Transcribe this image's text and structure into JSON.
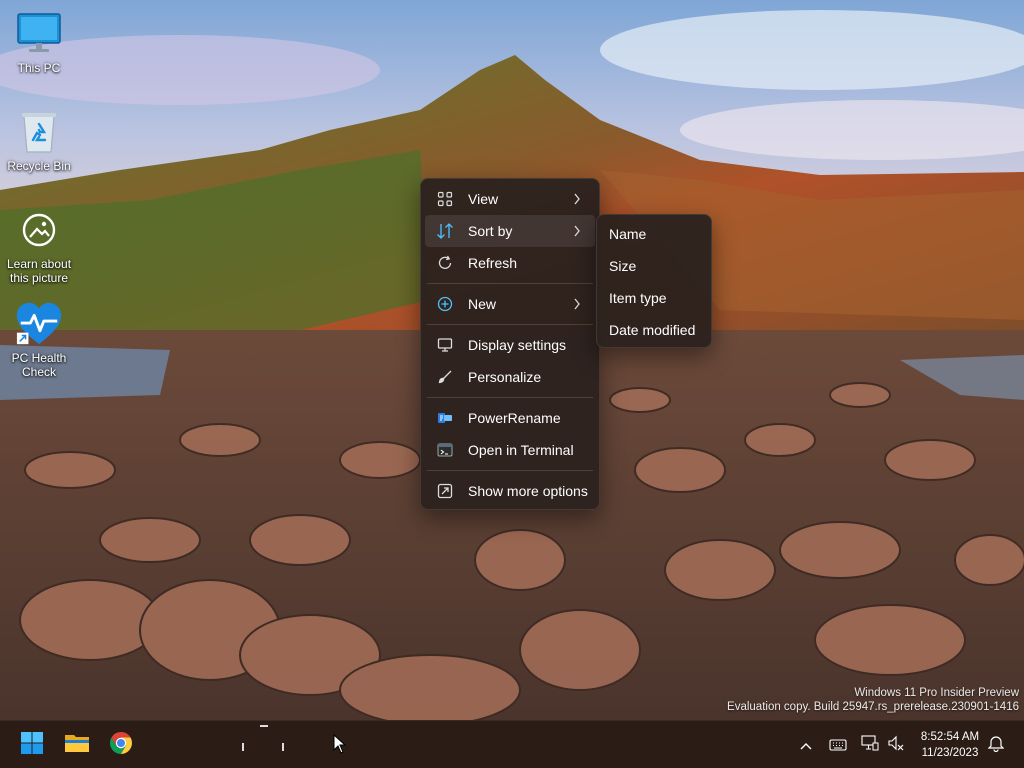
{
  "desktop": {
    "icons": [
      {
        "label": "This PC",
        "icon": "monitor-icon"
      },
      {
        "label": "Recycle Bin",
        "icon": "recycle-bin-icon"
      },
      {
        "label": "Learn about this picture",
        "icon": "camera-info-icon"
      },
      {
        "label": "PC Health Check",
        "icon": "health-heart-icon"
      }
    ]
  },
  "context_menu": {
    "items": [
      {
        "label": "View",
        "icon": "grid-icon",
        "submenu": true
      },
      {
        "label": "Sort by",
        "icon": "sort-icon",
        "submenu": true,
        "active": true
      },
      {
        "label": "Refresh",
        "icon": "refresh-icon"
      },
      {
        "label": "New",
        "icon": "plus-circle-icon",
        "submenu": true
      },
      {
        "label": "Display settings",
        "icon": "display-icon"
      },
      {
        "label": "Personalize",
        "icon": "brush-icon"
      },
      {
        "label": "PowerRename",
        "icon": "powerrename-icon"
      },
      {
        "label": "Open in Terminal",
        "icon": "terminal-icon"
      },
      {
        "label": "Show more options",
        "icon": "more-options-icon"
      }
    ],
    "sort_submenu": [
      "Name",
      "Size",
      "Item type",
      "Date modified"
    ]
  },
  "watermark": {
    "line1": "Windows 11 Pro Insider Preview",
    "line2": "Evaluation copy. Build 25947.rs_prerelease.230901-1416"
  },
  "taskbar": {
    "apps": [
      "start-icon",
      "file-explorer-icon",
      "chrome-icon"
    ],
    "tray": [
      "chevron-up-icon",
      "keyboard-icon",
      "network-icon",
      "volume-muted-icon",
      "notification-bell-icon"
    ],
    "time": "8:52:54 AM",
    "date": "11/23/2023"
  },
  "colors": {
    "menu_bg": "#2c221e",
    "taskbar_bg": "#2b1d16",
    "accent": "#4cc2ff"
  }
}
